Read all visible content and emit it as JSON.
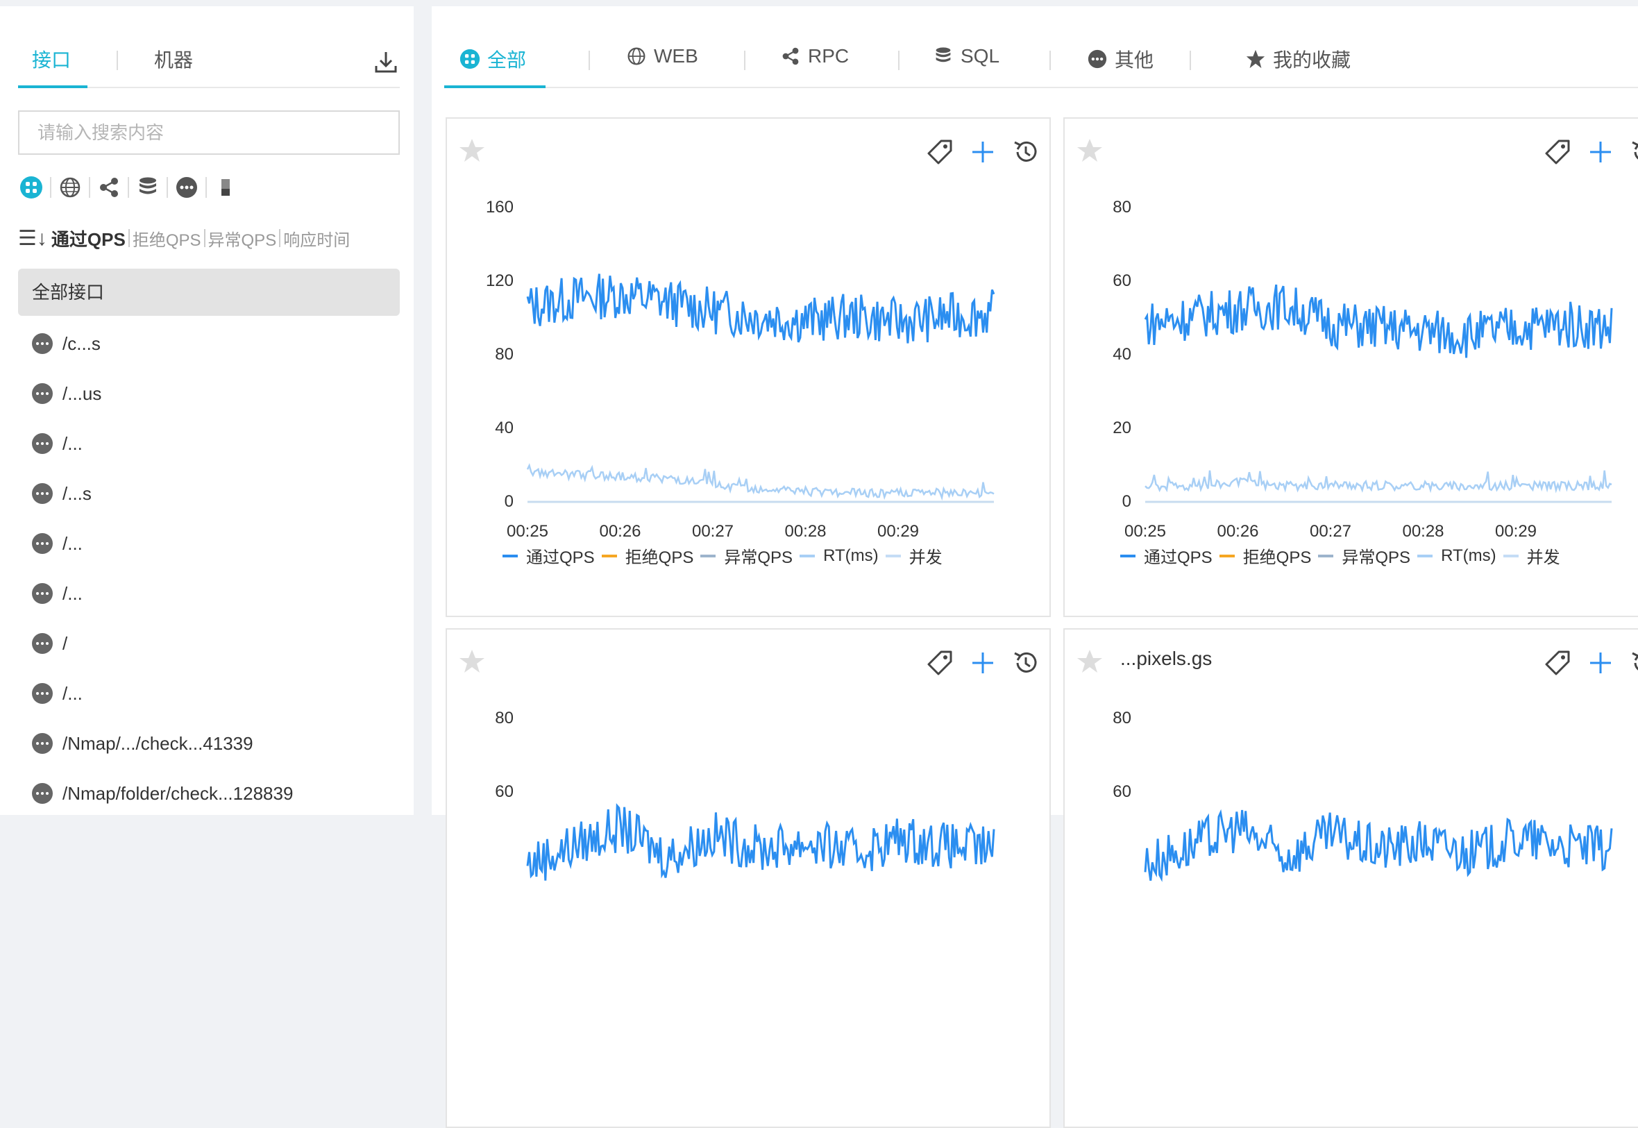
{
  "sidebar": {
    "tabs": [
      "接口",
      "机器"
    ],
    "search_placeholder": "请输入搜索内容",
    "sort": {
      "active": "通过QPS",
      "options": [
        "拒绝QPS",
        "异常QPS",
        "响应时间"
      ]
    },
    "all_label": "全部接口",
    "items": [
      "/c...s",
      "/...us",
      "/...",
      "/...s",
      "/...",
      "/...",
      "/",
      "/...",
      "/Nmap/.../check...41339",
      "/Nmap/folder/check...128839"
    ]
  },
  "main": {
    "tabs": [
      {
        "label": "全部",
        "icon": "grid-icon"
      },
      {
        "label": "WEB",
        "icon": "globe-icon"
      },
      {
        "label": "RPC",
        "icon": "share-icon"
      },
      {
        "label": "SQL",
        "icon": "database-icon"
      },
      {
        "label": "其他",
        "icon": "more-icon"
      },
      {
        "label": "我的收藏",
        "icon": "star-icon"
      }
    ]
  },
  "cards": [
    {
      "title": ""
    },
    {
      "title": ""
    },
    {
      "title": ""
    },
    {
      "title": "...pixels.gs"
    }
  ],
  "legend": [
    "通过QPS",
    "拒绝QPS",
    "异常QPS",
    "RT(ms)",
    "并发"
  ],
  "colors": {
    "accent": "#1ab4d3",
    "pass": "#2b8ef0",
    "block": "#f5a623",
    "exception": "#9db4cc",
    "rt": "#a8cff5",
    "concurrency": "#c5ddf5"
  },
  "chart_data": [
    {
      "type": "line",
      "x": [
        "00:25",
        "00:26",
        "00:27",
        "00:28",
        "00:29"
      ],
      "yticks": [
        0,
        40,
        80,
        120,
        160
      ],
      "ylim": [
        0,
        160
      ],
      "series": [
        {
          "name": "通过QPS",
          "values": [
            105,
            110,
            112,
            108,
            103,
            100,
            98,
            100,
            97,
            100,
            102
          ]
        },
        {
          "name": "RT(ms)",
          "values": [
            15,
            14,
            13,
            12,
            8,
            6,
            5,
            4,
            4,
            4,
            4
          ]
        }
      ]
    },
    {
      "type": "line",
      "x": [
        "00:25",
        "00:26",
        "00:27",
        "00:28",
        "00:29"
      ],
      "yticks": [
        0,
        20,
        40,
        60,
        80
      ],
      "ylim": [
        0,
        80
      ],
      "series": [
        {
          "name": "通过QPS",
          "values": [
            48,
            50,
            52,
            53,
            48,
            47,
            46,
            45,
            47,
            48,
            47
          ]
        },
        {
          "name": "RT(ms)",
          "values": [
            4,
            4,
            5,
            4,
            4,
            4,
            4,
            4,
            4,
            4,
            4
          ]
        }
      ]
    },
    {
      "type": "line",
      "yticks": [
        60,
        80
      ],
      "ylim": [
        0,
        80
      ]
    },
    {
      "type": "line",
      "yticks": [
        60,
        80
      ],
      "ylim": [
        0,
        80
      ]
    }
  ]
}
